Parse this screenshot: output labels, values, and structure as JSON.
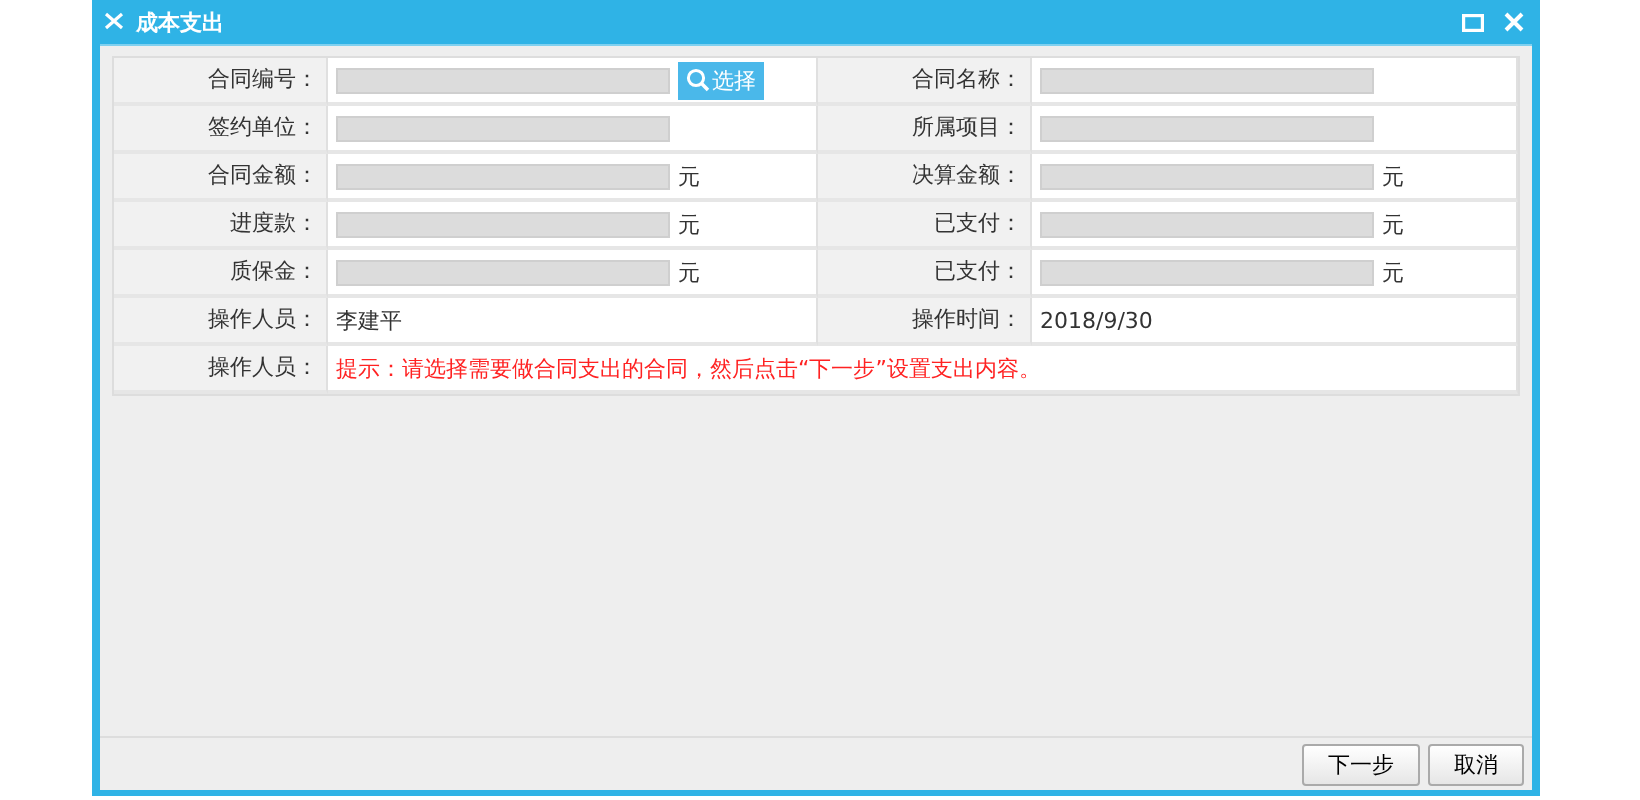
{
  "window": {
    "title": "成本支出"
  },
  "form": {
    "fields": [
      {
        "label": "合同编号：",
        "kind": "input",
        "button": "选择"
      },
      {
        "label": "合同名称：",
        "kind": "input"
      },
      {
        "label": "签约单位：",
        "kind": "input"
      },
      {
        "label": "所属项目：",
        "kind": "input"
      },
      {
        "label": "合同金额：",
        "kind": "input",
        "unit": "元"
      },
      {
        "label": "决算金额：",
        "kind": "input",
        "unit": "元"
      },
      {
        "label": "进度款：",
        "kind": "input",
        "unit": "元"
      },
      {
        "label": "已支付：",
        "kind": "input",
        "unit": "元"
      },
      {
        "label": "质保金：",
        "kind": "input",
        "unit": "元"
      },
      {
        "label": "已支付：",
        "kind": "input",
        "unit": "元"
      },
      {
        "label": "操作人员：",
        "kind": "text",
        "value": "李建平"
      },
      {
        "label": "操作时间：",
        "kind": "text",
        "value": "2018/9/30"
      },
      {
        "label": "操作人员：",
        "kind": "hint",
        "value": "提示：请选择需要做合同支出的合同，然后点击“下一步”设置支出内容。"
      }
    ]
  },
  "buttons": [
    "下一步",
    "取消"
  ]
}
